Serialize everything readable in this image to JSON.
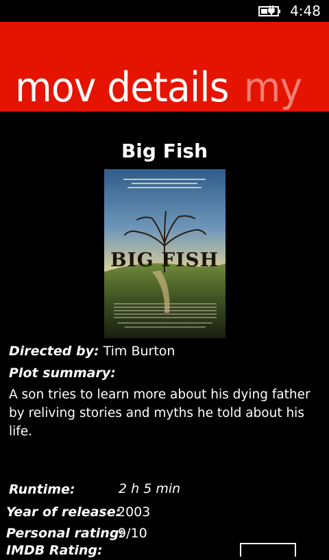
{
  "status": {
    "time": "4:48",
    "icons": [
      "battery-charging-icon"
    ]
  },
  "header": {
    "active_pivot": "mov details",
    "next_pivot": "my"
  },
  "movie": {
    "title": "Big Fish",
    "poster_title": "BIG FISH",
    "directed_by_label": "Directed by:",
    "director": "Tim Burton",
    "plot_label": "Plot summary:",
    "plot": "A son tries to learn more about his dying father by reliving stories and myths he told about his life.",
    "runtime_label": "Runtime:",
    "runtime": "2 h 5 min",
    "year_label": "Year of release:",
    "year": "2003",
    "rating_label": "Personal rating:",
    "rating": "9/10",
    "imdb_label": "IMDB Rating:"
  },
  "colors": {
    "accent": "#e51400",
    "background": "#000000",
    "text": "#ffffff"
  }
}
